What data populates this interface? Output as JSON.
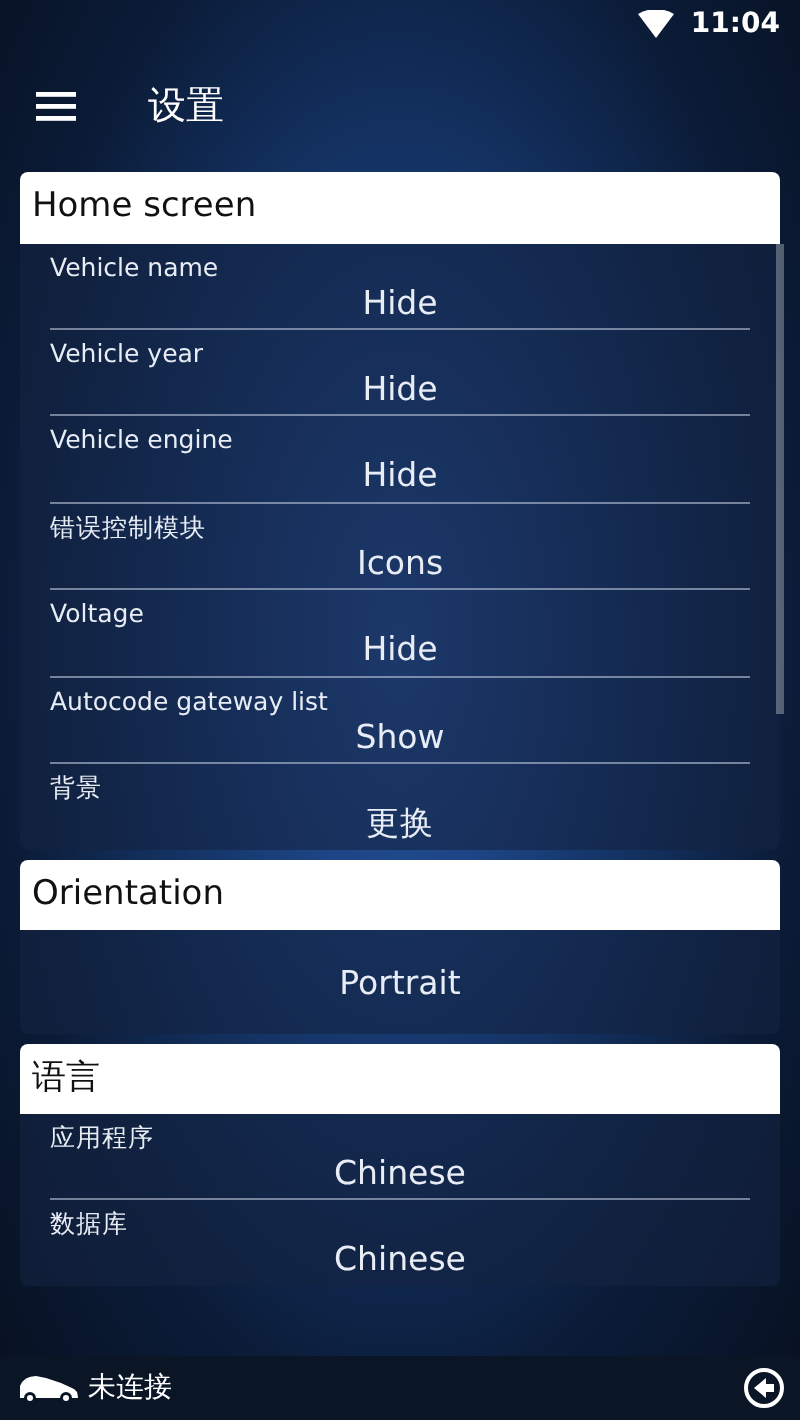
{
  "status_bar": {
    "time": "11:04"
  },
  "app_bar": {
    "title": "设置"
  },
  "sections": [
    {
      "title": "Home screen",
      "rows": [
        {
          "label": "Vehicle name",
          "value": "Hide"
        },
        {
          "label": "Vehicle year",
          "value": "Hide"
        },
        {
          "label": "Vehicle engine",
          "value": "Hide"
        },
        {
          "label": "错误控制模块",
          "value": "Icons"
        },
        {
          "label": "Voltage",
          "value": "Hide"
        },
        {
          "label": "Autocode gateway list",
          "value": "Show"
        },
        {
          "label": "背景",
          "value": "更换"
        }
      ]
    },
    {
      "title": "Orientation",
      "rows": [
        {
          "value": "Portrait"
        }
      ]
    },
    {
      "title": "语言",
      "rows": [
        {
          "label": "应用程序",
          "value": "Chinese"
        },
        {
          "label": "数据库",
          "value": "Chinese"
        }
      ]
    }
  ],
  "bottom_bar": {
    "connection": "未连接"
  }
}
